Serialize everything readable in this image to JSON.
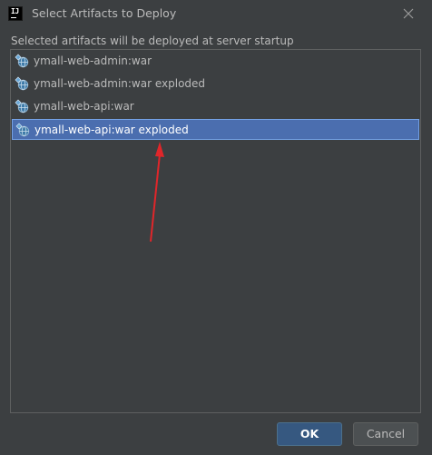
{
  "window": {
    "title": "Select Artifacts to Deploy",
    "app_icon_text": "IJ"
  },
  "subtitle": "Selected artifacts will be deployed at server startup",
  "artifacts": [
    {
      "label": "ymall-web-admin:war",
      "selected": false,
      "icon": "artifact-icon"
    },
    {
      "label": "ymall-web-admin:war exploded",
      "selected": false,
      "icon": "artifact-icon"
    },
    {
      "label": "ymall-web-api:war",
      "selected": false,
      "icon": "artifact-icon"
    },
    {
      "label": "ymall-web-api:war exploded",
      "selected": true,
      "icon": "artifact-icon"
    }
  ],
  "buttons": {
    "ok": "OK",
    "cancel": "Cancel"
  },
  "colors": {
    "background": "#3c3f41",
    "selection": "#4b6eaf",
    "selection_border": "#75a3e8",
    "annotation_arrow": "#e0262a",
    "ok_button": "#365880",
    "text": "#bbbbbb"
  }
}
